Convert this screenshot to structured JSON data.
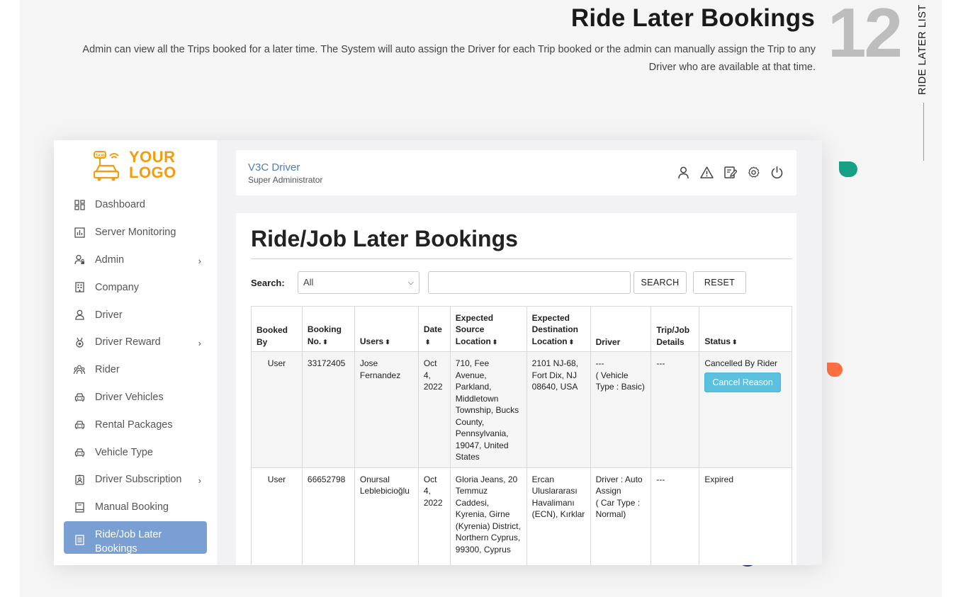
{
  "hero": {
    "title": "Ride Later Bookings",
    "number": "12",
    "side_label": "RIDE LATER LIST",
    "description": "Admin can view all the Trips booked for a later time. The System will auto assign the Driver for each Trip booked or the admin can manually assign the Trip to any Driver who are available at that time."
  },
  "logo": {
    "line1": "YOUR",
    "line2": "LOGO",
    "color": "#f39c12"
  },
  "sidebar": {
    "active_color": "#7a9fd2",
    "items": [
      {
        "label": "Dashboard",
        "icon": "dashboard-icon",
        "chevron": false
      },
      {
        "label": "Server Monitoring",
        "icon": "bar-chart-icon",
        "chevron": false
      },
      {
        "label": "Admin",
        "icon": "user-lock-icon",
        "chevron": true
      },
      {
        "label": "Company",
        "icon": "building-icon",
        "chevron": false
      },
      {
        "label": "Driver",
        "icon": "user-icon",
        "chevron": false
      },
      {
        "label": "Driver Reward",
        "icon": "medal-icon",
        "chevron": true
      },
      {
        "label": "Rider",
        "icon": "users-icon",
        "chevron": false
      },
      {
        "label": "Driver Vehicles",
        "icon": "car-icon",
        "chevron": false
      },
      {
        "label": "Rental Packages",
        "icon": "car-icon",
        "chevron": false
      },
      {
        "label": "Vehicle Type",
        "icon": "car-icon",
        "chevron": false
      },
      {
        "label": "Driver Subscription",
        "icon": "id-badge-icon",
        "chevron": true
      },
      {
        "label": "Manual Booking",
        "icon": "book-icon",
        "chevron": false
      },
      {
        "label": "Ride/Job Later Bookings",
        "icon": "list-icon",
        "chevron": false,
        "active": true
      }
    ]
  },
  "topbar": {
    "title": "V3C Driver",
    "subtitle": "Super Administrator",
    "icons": [
      "user-icon",
      "warning-icon",
      "edit-icon",
      "settings-icon",
      "power-icon"
    ]
  },
  "main": {
    "title": "Ride/Job Later Bookings",
    "search_label": "Search:",
    "search_select_value": "All",
    "search_input_value": "",
    "search_button": "SEARCH",
    "reset_button": "RESET"
  },
  "table": {
    "headers": {
      "booked_by": "Booked By",
      "booking_no": "Booking No.",
      "users": "Users",
      "date": "Date",
      "source": "Expected Source Location",
      "destination": "Expected Destination Location",
      "driver": "Driver",
      "trip_details": "Trip/Job Details",
      "status": "Status"
    },
    "rows": [
      {
        "booked_by": "User",
        "booking_no": "33172405",
        "user": "Jose Fernandez",
        "date": "Oct 4, 2022",
        "source": "710, Fee Avenue, Parkland, Middletown Township, Bucks County, Pennsylvania, 19047, United States",
        "destination": "2101 NJ-68, Fort Dix, NJ 08640, USA",
        "driver": "---",
        "driver_extra": "( Vehicle Type : Basic)",
        "trip_details": "---",
        "status": "Cancelled By Rider",
        "action": "Cancel Reason"
      },
      {
        "booked_by": "User",
        "booking_no": "66652798",
        "user": "Onursal Leblebicioğlu",
        "date": "Oct 4, 2022",
        "source": "Gloria Jeans, 20 Temmuz Caddesi, Kyrenia, Girne (Kyrenia) District, Northern Cyprus, 99300, Cyprus",
        "destination": "Ercan Uluslararası Havalimanı (ECN), Kırklar",
        "driver": "Driver : Auto Assign",
        "driver_extra": "( Car Type : Normal)",
        "trip_details": "---",
        "status": "Expired"
      }
    ]
  }
}
